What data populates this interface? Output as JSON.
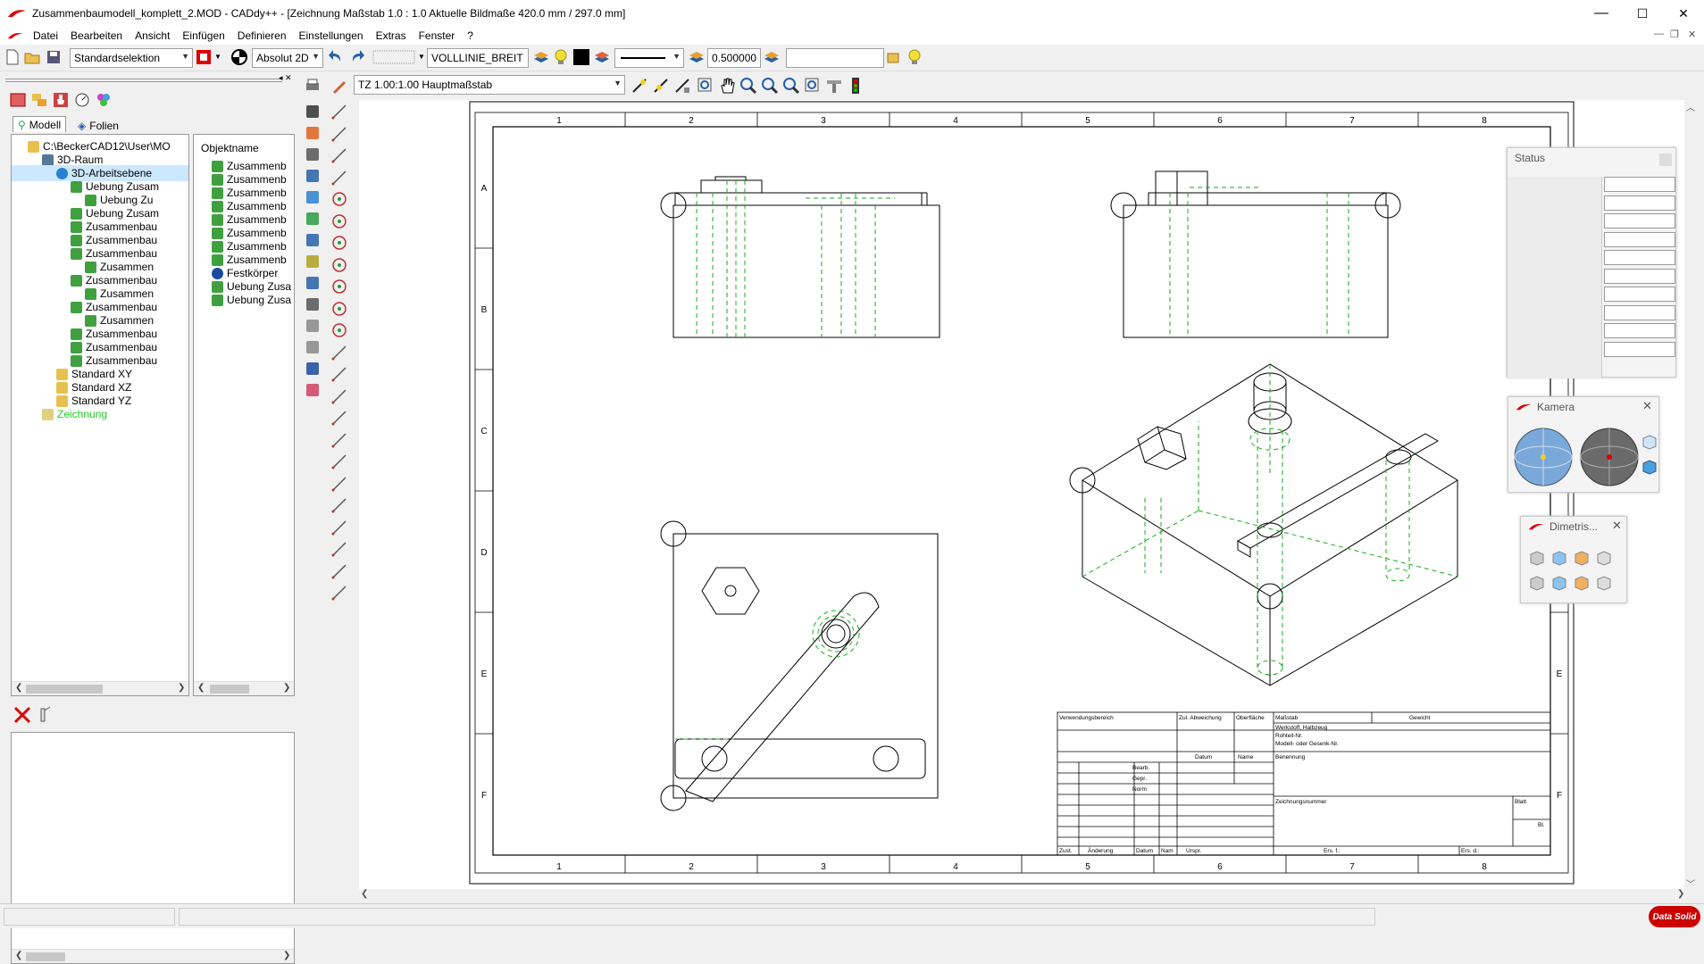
{
  "window": {
    "title": "Zusammenbaumodell_komplett_2.MOD  -  CADdy++ - [Zeichnung   Maßstab 1.0 : 1.0   Aktuelle Bildmaße 420.0 mm / 297.0 mm]",
    "minimize": "—",
    "maximize": "☐",
    "close": "✕"
  },
  "menu": [
    "Datei",
    "Bearbeiten",
    "Ansicht",
    "Einfügen",
    "Definieren",
    "Einstellungen",
    "Extras",
    "Fenster",
    "?"
  ],
  "toolbar": {
    "selection_mode": "Standardselektion",
    "coord_mode": "Absolut 2D",
    "line_type": "VOLLLINIE_BREIT",
    "line_width": "0.500000",
    "layer_field": ""
  },
  "toolbar2": {
    "scale_select": "TZ 1.00:1.00 Hauptmaßstab"
  },
  "left_panel": {
    "tabs": [
      "Modell",
      "Folien"
    ],
    "tree": [
      {
        "label": "C:\\BeckerCAD12\\User\\MO",
        "indent": 0,
        "icon": "folder-icon"
      },
      {
        "label": "3D-Raum",
        "indent": 1,
        "icon": "cube-icon"
      },
      {
        "label": "3D-Arbeitsebene",
        "indent": 2,
        "icon": "globe-icon",
        "selected": true
      },
      {
        "label": "Uebung Zusam",
        "indent": 3,
        "icon": "part-icon"
      },
      {
        "label": "Uebung Zu",
        "indent": 4,
        "icon": "part-icon"
      },
      {
        "label": "Uebung Zusam",
        "indent": 3,
        "icon": "part-icon"
      },
      {
        "label": "Zusammenbau",
        "indent": 3,
        "icon": "part-icon"
      },
      {
        "label": "Zusammenbau",
        "indent": 3,
        "icon": "part-icon"
      },
      {
        "label": "Zusammenbau",
        "indent": 3,
        "icon": "part-icon"
      },
      {
        "label": "Zusammen",
        "indent": 4,
        "icon": "part-icon"
      },
      {
        "label": "Zusammenbau",
        "indent": 3,
        "icon": "part-icon"
      },
      {
        "label": "Zusammen",
        "indent": 4,
        "icon": "part-icon"
      },
      {
        "label": "Zusammenbau",
        "indent": 3,
        "icon": "part-icon"
      },
      {
        "label": "Zusammen",
        "indent": 4,
        "icon": "part-icon"
      },
      {
        "label": "Zusammenbau",
        "indent": 3,
        "icon": "part-icon"
      },
      {
        "label": "Zusammenbau",
        "indent": 3,
        "icon": "part-icon"
      },
      {
        "label": "Zusammenbau",
        "indent": 3,
        "icon": "part-icon"
      },
      {
        "label": "Standard XY",
        "indent": 2,
        "icon": "folder-icon"
      },
      {
        "label": "Standard XZ",
        "indent": 2,
        "icon": "folder-icon"
      },
      {
        "label": "Standard YZ",
        "indent": 2,
        "icon": "folder-icon"
      },
      {
        "label": "Zeichnung",
        "indent": 1,
        "icon": "drawing-icon",
        "green": true
      }
    ],
    "object_header": "Objektname",
    "objects": [
      "Zusammenb",
      "Zusammenb",
      "Zusammenb",
      "Zusammenb",
      "Zusammenb",
      "Zusammenb",
      "Zusammenb",
      "Zusammenb",
      "Festkörper",
      "Uebung Zusa",
      "Uebung Zusa"
    ]
  },
  "sheet": {
    "col_labels": [
      "1",
      "2",
      "3",
      "4",
      "5",
      "6",
      "7",
      "8"
    ],
    "row_labels": [
      "A",
      "B",
      "C",
      "D",
      "E",
      "F"
    ],
    "title_block": {
      "verwendungsbereich": "Verwendungsbereich",
      "zul_abweichung": "Zul. Abweichung",
      "oberflaeche": "Oberfläche",
      "massstab": "Maßstab",
      "gewicht": "Gewicht",
      "werkstoff": "Werkstoff, Halbzeug",
      "rohteil": "Rohteil-Nr.",
      "modell": "Modell- oder Gesenk-Nr.",
      "datum": "Datum",
      "name": "Name",
      "benennung": "Benennung",
      "bearb": "Bearb.",
      "gepr": "Gepr.",
      "norm": "Norm",
      "zeichnungsnummer": "Zeichnungsnummer",
      "blatt": "Blatt",
      "bl": "Bl.",
      "zust": "Zust.",
      "aenderung": "Änderung",
      "datum2": "Datum",
      "nam": "Nam",
      "urspr": "Urspr.",
      "ers_f": "Ers. f.:",
      "ers_d": "Ers. d.:"
    }
  },
  "floating": {
    "status_title": "Status",
    "camera_title": "Kamera",
    "dimetric_title": "Dimetris..."
  },
  "brand": "Data Solid",
  "colors": {
    "hidden_line": "#1aaa1a",
    "selection": "#cce8ff",
    "accent": "#cc0000"
  }
}
